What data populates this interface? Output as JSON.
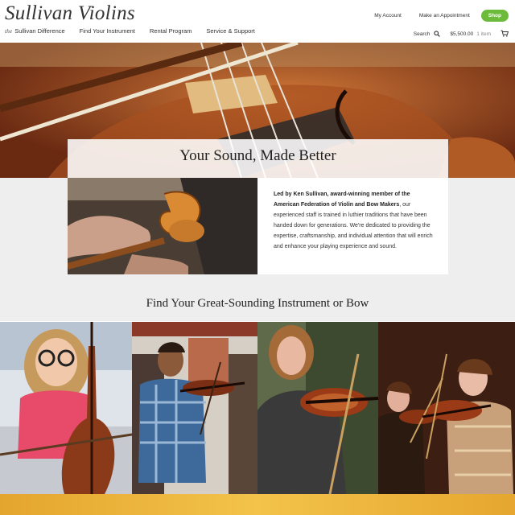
{
  "header": {
    "logo_text": "Sullivan Violins",
    "nav": [
      {
        "prefix": "the",
        "label": "Sullivan Difference"
      },
      {
        "prefix": "",
        "label": "Find Your Instrument"
      },
      {
        "prefix": "",
        "label": "Rental Program"
      },
      {
        "prefix": "",
        "label": "Service & Support"
      }
    ],
    "my_account": "My Account",
    "make_appointment": "Make an Appointment",
    "shop": "Shop",
    "search_label": "Search",
    "cart_total": "$5,500.00",
    "cart_items": "1 item"
  },
  "hero": {
    "title": "Your Sound, Made Better"
  },
  "intro": {
    "bold_text": "Led by Ken Sullivan, award-winning member of the American Federation of Violin and Bow Makers",
    "body_text": ", our experienced staff is trained in luthier traditions that have been handed down for generations. We're dedicated to providing the expertise, craftsmanship, and individual attention that will enrich and enhance your playing experience and sound."
  },
  "find_section": {
    "title": "Find Your Great-Sounding Instrument or Bow"
  },
  "colors": {
    "shop_green": "#6dbb3a",
    "gray_band": "#eeeeee",
    "gold_band": "#f3c34a"
  },
  "icons": [
    "search-icon",
    "cart-icon"
  ]
}
